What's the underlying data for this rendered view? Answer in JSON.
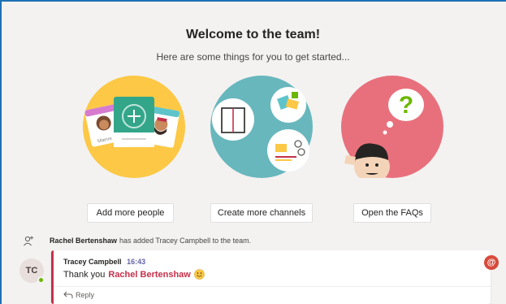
{
  "welcome": {
    "title": "Welcome to the team!",
    "subtitle": "Here are some things for you to get started..."
  },
  "actions": [
    {
      "label": "Add more people"
    },
    {
      "label": "Create more channels"
    },
    {
      "label": "Open the FAQs"
    }
  ],
  "illustrations": {
    "people_card_name": "Maeve"
  },
  "activity": {
    "actor": "Rachel Bertenshaw",
    "text": "has added Tracey Campbell to the team."
  },
  "message": {
    "avatar_initials": "TC",
    "author": "Tracey Campbell",
    "time": "16:43",
    "body": "Thank you",
    "mention": "Rachel Bertenshaw",
    "emoji": "smile-emoji",
    "reply_label": "Reply"
  },
  "mention_badge": "@",
  "colors": {
    "frame": "#1f6fb5",
    "mention": "#c4314b",
    "time": "#6264a7",
    "badge": "#d74a3b",
    "presence": "#6bb700"
  }
}
